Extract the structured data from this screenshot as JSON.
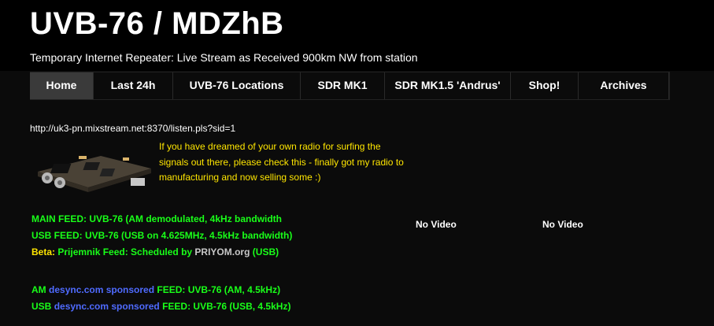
{
  "header": {
    "title": "UVB-76 / MDZhB",
    "tagline": "Temporary Internet Repeater: Live Stream as Received 900km NW from station"
  },
  "nav": {
    "items": [
      {
        "label": "Home",
        "active": true
      },
      {
        "label": "Last 24h"
      },
      {
        "label": "UVB-76 Locations"
      },
      {
        "label": "SDR MK1"
      },
      {
        "label": "SDR MK1.5 'Andrus'"
      },
      {
        "label": "Shop!"
      },
      {
        "label": "Archives"
      }
    ]
  },
  "main": {
    "stream_url": "http://uk3-pn.mixstream.net:8370/listen.pls?sid=1",
    "promo_text": "If you have dreamed of your own radio for surfing the signals out there, please check this - finally got my radio to manufacturing and now selling some :)",
    "feeds": {
      "main_feed": "MAIN FEED: UVB-76 (AM demodulated, 4kHz bandwidth",
      "usb_feed": "USB FEED: UVB-76 (USB on 4.625MHz, 4.5kHz bandwidth)",
      "beta_label": "Beta:",
      "beta_text": "Prijemnik Feed: Scheduled by",
      "beta_link": "PRIYOM.org",
      "beta_suffix": "(USB)",
      "am_prefix": "AM",
      "am_sponsor": "desync.com sponsored",
      "am_text": "FEED: UVB-76 (AM, 4.5kHz)",
      "usb_prefix": "USB",
      "usb_sponsor": "desync.com sponsored",
      "usb_text": "FEED: UVB-76 (USB, 4.5kHz)"
    },
    "video_left": "No Video",
    "video_right": "No Video"
  },
  "colors": {
    "background": "#000000",
    "feed_green": "#19ff19",
    "promo_yellow": "#ffe600",
    "sponsor_blue": "#4f6bff"
  }
}
